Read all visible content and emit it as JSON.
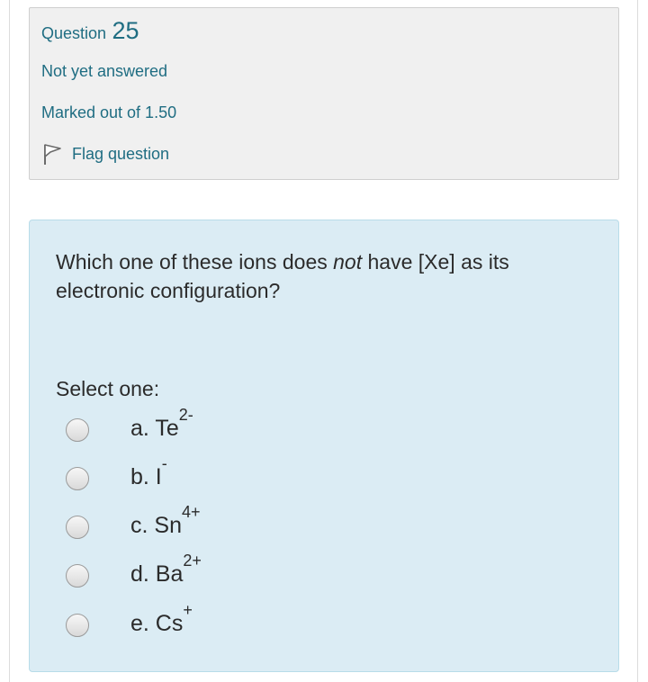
{
  "question": {
    "label": "Question",
    "number": "25",
    "state": "Not yet answered",
    "grade": "Marked out of 1.50",
    "flag_label": "Flag question",
    "flag_icon": "flag-icon",
    "text_before": "Which one of these ions does ",
    "text_em": "not",
    "text_after": " have [Xe] as its electronic configuration?"
  },
  "answer": {
    "prompt": "Select one:",
    "options": [
      {
        "label": "a. Te",
        "charge": "2-"
      },
      {
        "label": "b. I",
        "charge": "-"
      },
      {
        "label": "c. Sn",
        "charge": "4+"
      },
      {
        "label": "d. Ba",
        "charge": "2+"
      },
      {
        "label": "e. Cs",
        "charge": "+"
      }
    ]
  },
  "colors": {
    "accent": "#1f6d82",
    "info_bg": "#f0f0f0",
    "content_bg": "#dbecf4"
  }
}
